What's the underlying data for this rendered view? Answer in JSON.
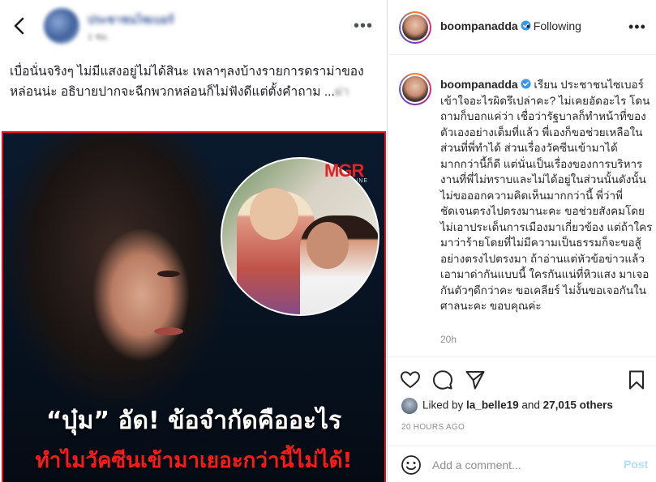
{
  "fb_post": {
    "author_name": "ประชาชนไซเบอร์",
    "time": "1 ชม.",
    "caption_main": "เบื่อนั่นจริงๆ ไม่มีแสงอยู่ไม่ได้สินะ เพลาๆลงบ้างรายการดราม่าของหล่อนน่ะ อธิบายปากจะฉีกพวกหล่อนก็ไม่ฟังดีแต่ตั้งคำถาม ...",
    "caption_tail": "ผ่า",
    "more_label": "•••",
    "image": {
      "logo": "MGR",
      "logo_sub": "ONLINE",
      "headline_line1": "“บุ๋ม” อัด! ข้อจำกัดคืออะไร",
      "headline_line2": "ทำไมวัคซีนเข้ามาเยอะกว่านี้ไม่ได้!"
    }
  },
  "ig": {
    "username": "boompanadda",
    "following_label": "• Following",
    "more_label": "•••",
    "comment_username": "boompanadda",
    "comment_lead": " เรียน ประชาชนไซเบอร์",
    "comment_body": "เข้าใจอะไรผิดรึเปล่าคะ? ไม่เคยอัดอะไร โดนถามก็บอกแค่ว่า เชื่อว่ารัฐบาลก็ทำหน้าที่ของตัวเองอย่างเต็มที่แล้ว พี่เองก็ขอช่วยเหลือในส่วนที่พี่ทำได้ ส่วนเรื่องวัคซีนเข้ามาได้มากกว่านี้ก็ดี แต่นั่นเป็นเรื่องของการบริหารงานที่พี่ไม่ทราบและไม่ได้อยู่ในส่วนนั้นดังนั้นไม่ขอออกความคิดเห็นมากกว่านี้ พี่ว่าพี่ชัดเจนตรงไปตรงมานะคะ ขอช่วยสังคมโดยไม่เอาประเด็นการเมืองมาเกี่ยวข้อง แต่ถ้าใครมาว่าร้ายโดยที่ไม่มีความเป็นธรรมก็จะขอสู้อย่างตรงไปตรงมา ถ้าอ่านแต่หัวข้อข่าวแล้วเอามาด่ากันแบบนี้ ใครกันแน่ที่หิวแสง มาเจอกันตัวๆดีกว่าคะ ขอเคลียร์ ไม่งั้นขอเจอกันในศาลนะคะ ขอบคุณค่ะ",
    "comment_time": "20h",
    "likes_prefix": "Liked by ",
    "likes_user": "la_belle19",
    "likes_mid": " and ",
    "likes_count": "27,015 others",
    "post_date": "20 HOURS AGO",
    "comment_placeholder": "Add a comment...",
    "post_button": "Post"
  },
  "icons": [
    "back-arrow-icon",
    "more-dots-icon",
    "verified-badge-icon",
    "heart-icon",
    "comment-icon",
    "share-icon",
    "bookmark-icon",
    "emoji-icon"
  ],
  "colors": {
    "fb_link": "#3b5998",
    "ig_verified": "#3897f0",
    "headline_red": "#ff1a1a",
    "image_border": "#e8131b",
    "post_button": "#b2dffc"
  }
}
